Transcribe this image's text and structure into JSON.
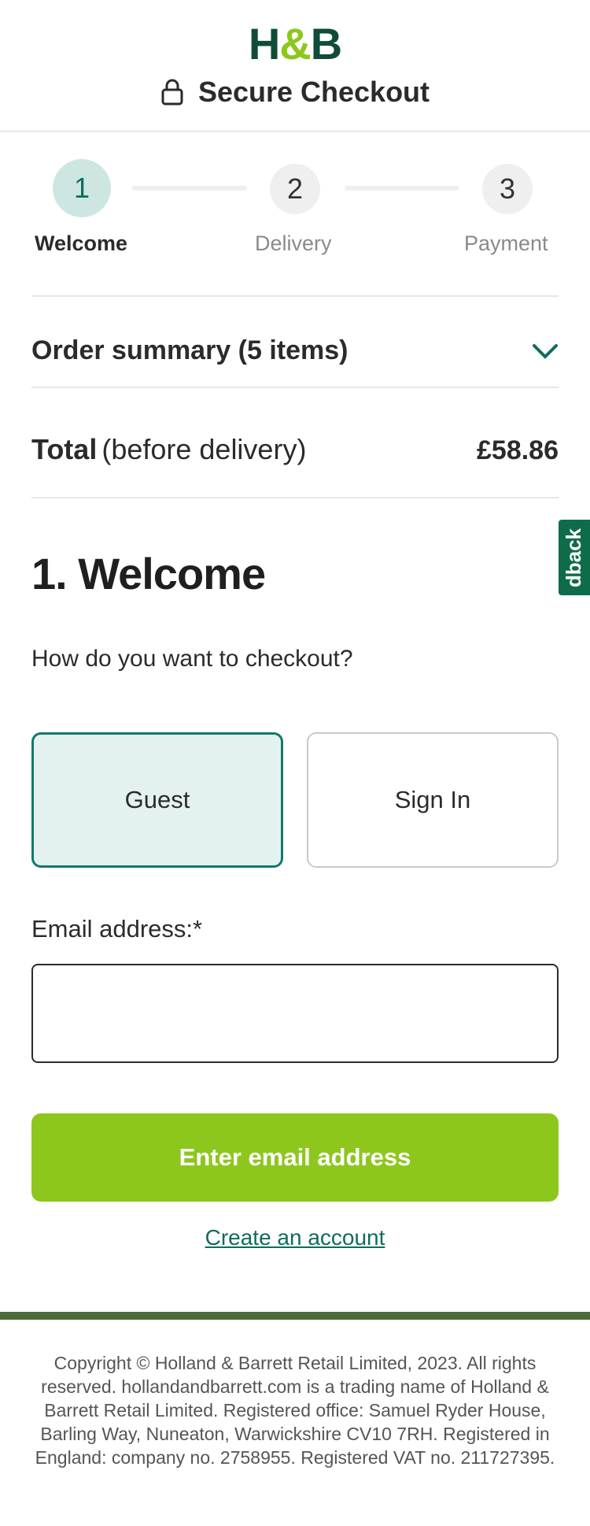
{
  "header": {
    "logo_left": "H",
    "logo_amp": "&",
    "logo_right": "B",
    "title": "Secure Checkout",
    "lock_icon": "lock-icon"
  },
  "steps": [
    {
      "number": "1",
      "label": "Welcome",
      "active": true
    },
    {
      "number": "2",
      "label": "Delivery",
      "active": false
    },
    {
      "number": "3",
      "label": "Payment",
      "active": false
    }
  ],
  "summary": {
    "title": "Order summary (5 items)",
    "toggle_icon": "chevron-down-icon"
  },
  "total": {
    "label": "Total",
    "sublabel": "(before delivery)",
    "price": "£58.86"
  },
  "feedback_tab": "dback",
  "welcome": {
    "title": "1. Welcome",
    "question": "How do you want to checkout?",
    "guest_label": "Guest",
    "signin_label": "Sign In",
    "selected": "Guest",
    "email_label": "Email address:*",
    "email_value": "",
    "email_placeholder": "",
    "submit_label": "Enter email address",
    "create_account": "Create an account"
  },
  "colors": {
    "brand_green": "#0f4c3a",
    "lime": "#8dc71e",
    "teal_selected": "#0f7a68",
    "footer_bar": "#4e6b3b"
  },
  "footer": {
    "copyright": "Copyright © Holland & Barrett Retail Limited, 2023. All rights reserved. hollandandbarrett.com is a trading name of Holland & Barrett Retail Limited. Registered office: Samuel Ryder House, Barling Way, Nuneaton, Warwickshire CV10 7RH. Registered in England: company no. 2758955. Registered VAT no. 211727395."
  }
}
